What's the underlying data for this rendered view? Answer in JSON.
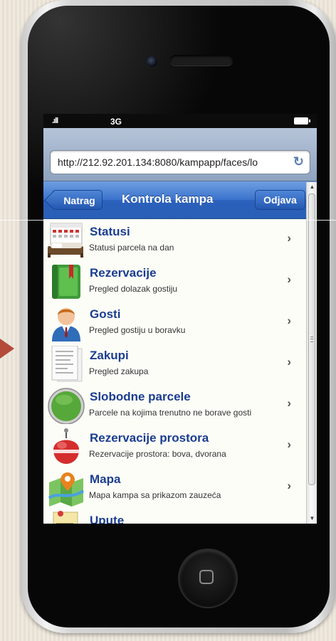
{
  "status_bar": {
    "signal": ".ıll",
    "network": "3G"
  },
  "browser": {
    "url": "http://212.92.201.134:8080/kampapp/faces/lo"
  },
  "navbar": {
    "back_label": "Natrag",
    "title": "Kontrola kampa",
    "logout_label": "Odjava"
  },
  "menu": {
    "items": [
      {
        "title": "Statusi",
        "subtitle": "Statusi parcela na dan",
        "icon": "calendar-bed-icon"
      },
      {
        "title": "Rezervacije",
        "subtitle": "Pregled dolazak gostiju",
        "icon": "green-book-icon"
      },
      {
        "title": "Gosti",
        "subtitle": "Pregled gostiju u boravku",
        "icon": "person-icon"
      },
      {
        "title": "Zakupi",
        "subtitle": "Pregled zakupa",
        "icon": "document-icon"
      },
      {
        "title": "Slobodne parcele",
        "subtitle": "Parcele na kojima trenutno ne borave gosti",
        "icon": "green-circle-icon"
      },
      {
        "title": "Rezervacije prostora",
        "subtitle": "Rezervacije prostora: bova, dvorana",
        "icon": "buoy-icon"
      },
      {
        "title": "Mapa",
        "subtitle": "Mapa kampa sa prikazom zauzeća",
        "icon": "map-pin-icon"
      },
      {
        "title": "Upute",
        "subtitle": "",
        "icon": "note-icon"
      }
    ],
    "chevron": "›"
  },
  "colors": {
    "navbar": "#2b61bc",
    "item_title": "#1a3d8f"
  }
}
